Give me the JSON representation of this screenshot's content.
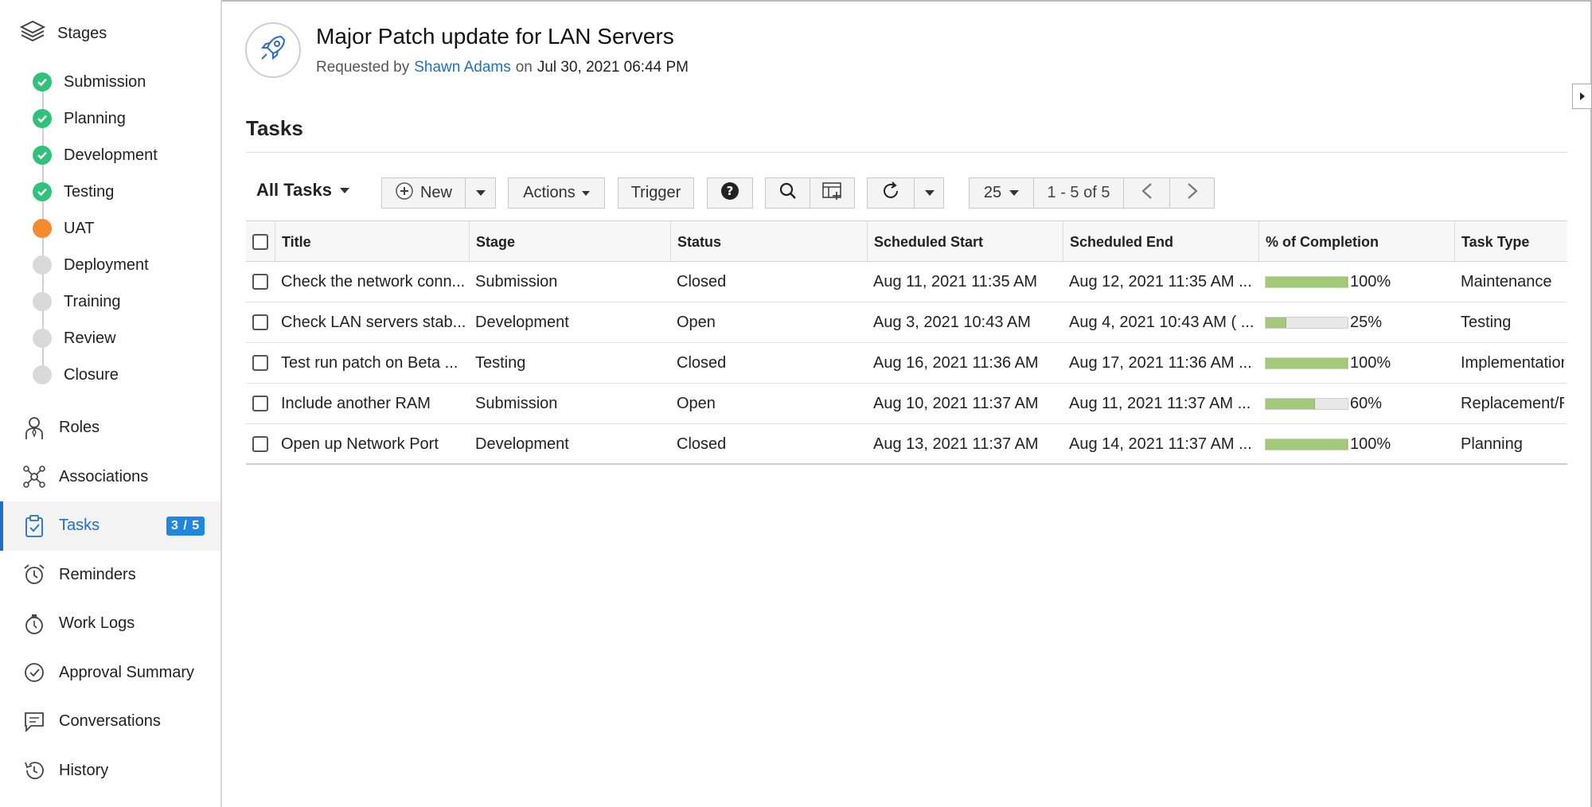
{
  "sidebar": {
    "stages_heading": "Stages",
    "stages": [
      {
        "label": "Submission",
        "state": "done"
      },
      {
        "label": "Planning",
        "state": "done"
      },
      {
        "label": "Development",
        "state": "done"
      },
      {
        "label": "Testing",
        "state": "done"
      },
      {
        "label": "UAT",
        "state": "current"
      },
      {
        "label": "Deployment",
        "state": "pending"
      },
      {
        "label": "Training",
        "state": "pending"
      },
      {
        "label": "Review",
        "state": "pending"
      },
      {
        "label": "Closure",
        "state": "pending"
      }
    ],
    "nav": [
      {
        "label": "Roles",
        "icon": "roles-icon"
      },
      {
        "label": "Associations",
        "icon": "associations-icon"
      },
      {
        "label": "Tasks",
        "icon": "tasks-icon",
        "badge": "3 / 5",
        "active": true
      },
      {
        "label": "Reminders",
        "icon": "alarm-clock-icon"
      },
      {
        "label": "Work Logs",
        "icon": "work-logs-icon"
      },
      {
        "label": "Approval Summary",
        "icon": "approval-check-icon"
      },
      {
        "label": "Conversations",
        "icon": "conversation-icon"
      },
      {
        "label": "History",
        "icon": "history-icon"
      }
    ]
  },
  "header": {
    "title": "Major Patch update for LAN Servers",
    "requested_by_label": "Requested by",
    "requester": "Shawn Adams",
    "on_label": "on",
    "date": "Jul 30, 2021 06:44 PM"
  },
  "tasks_section": {
    "title": "Tasks",
    "view_label": "All Tasks",
    "new_label": "New",
    "actions_label": "Actions",
    "trigger_label": "Trigger",
    "page_size": "25",
    "range_label": "1 - 5 of 5"
  },
  "table": {
    "columns": [
      "Title",
      "Stage",
      "Status",
      "Scheduled Start",
      "Scheduled End",
      "% of Completion",
      "Task Type"
    ],
    "rows": [
      {
        "title": "Check the network conn...",
        "stage": "Submission",
        "status": "Closed",
        "start": "Aug 11, 2021 11:35 AM",
        "end": "Aug 12, 2021 11:35 AM ...",
        "completion": 100,
        "completion_label": "100%",
        "type": "Maintenance"
      },
      {
        "title": "Check LAN servers stab...",
        "stage": "Development",
        "status": "Open",
        "start": "Aug 3, 2021 10:43 AM",
        "end": "Aug 4, 2021 10:43 AM ( ...",
        "completion": 25,
        "completion_label": "25%",
        "type": "Testing"
      },
      {
        "title": "Test run patch on Beta ...",
        "stage": "Testing",
        "status": "Closed",
        "start": "Aug 16, 2021 11:36 AM",
        "end": "Aug 17, 2021 11:36 AM ...",
        "completion": 100,
        "completion_label": "100%",
        "type": "Implementation"
      },
      {
        "title": "Include another RAM",
        "stage": "Submission",
        "status": "Open",
        "start": "Aug 10, 2021 11:37 AM",
        "end": "Aug 11, 2021 11:37 AM ...",
        "completion": 60,
        "completion_label": "60%",
        "type": "Replacement/R"
      },
      {
        "title": "Open up Network Port",
        "stage": "Development",
        "status": "Closed",
        "start": "Aug 13, 2021 11:37 AM",
        "end": "Aug 14, 2021 11:37 AM ...",
        "completion": 100,
        "completion_label": "100%",
        "type": "Planning"
      }
    ]
  },
  "colors": {
    "accent": "#1f6fc5",
    "done": "#2fc27a",
    "current": "#f58a2e",
    "pending": "#d9d9d9",
    "progress": "#a4c97a"
  }
}
